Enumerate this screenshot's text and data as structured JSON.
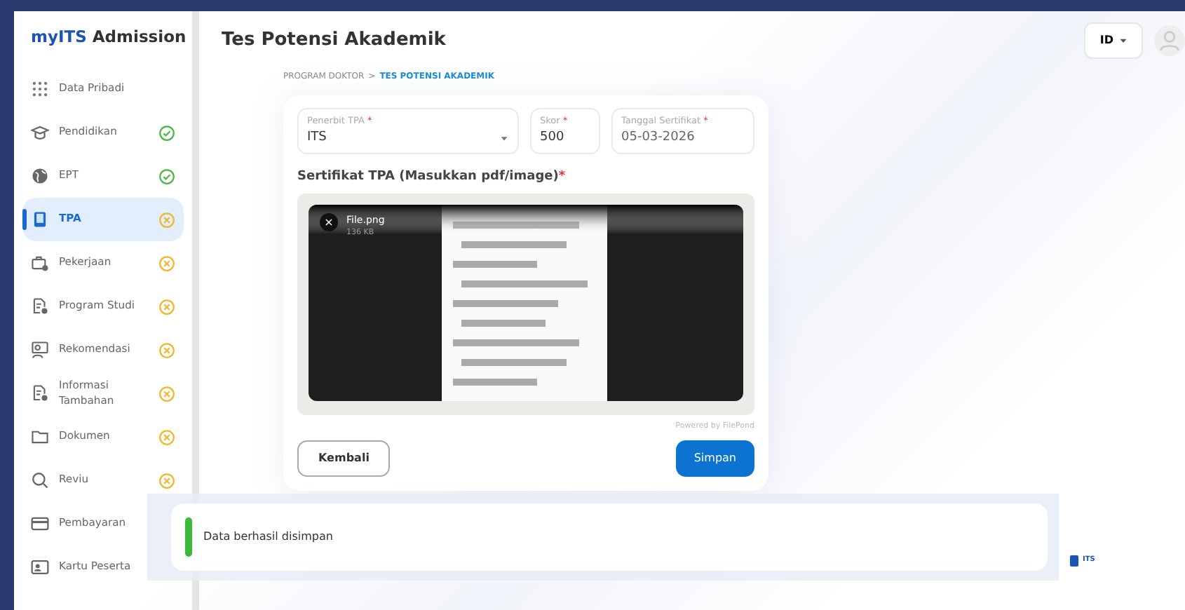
{
  "brand": {
    "prefix": "my",
    "main": "ITS",
    "suffix": "Admission"
  },
  "page_title": "Tes Potensi Akademik",
  "language": "ID",
  "sidebar": {
    "items": [
      {
        "label": "Data Pribadi",
        "kind": "plain",
        "selected": false
      },
      {
        "label": "Pendidikan",
        "kind": "complete",
        "selected": false
      },
      {
        "label": "EPT",
        "kind": "complete",
        "selected": false
      },
      {
        "label": "TPA",
        "kind": "incomplete",
        "selected": true
      },
      {
        "label": "Pekerjaan",
        "kind": "incomplete",
        "selected": false
      },
      {
        "label": "Program Studi",
        "kind": "incomplete",
        "selected": false
      },
      {
        "label": "Rekomendasi",
        "kind": "incomplete",
        "selected": false
      },
      {
        "label": "Informasi Tambahan",
        "kind": "incomplete",
        "selected": false
      },
      {
        "label": "Dokumen",
        "kind": "incomplete",
        "selected": false
      },
      {
        "label": "Reviu",
        "kind": "incomplete",
        "selected": false
      },
      {
        "label": "Pembayaran",
        "kind": "plain",
        "selected": false
      },
      {
        "label": "Kartu Peserta",
        "kind": "plain",
        "selected": false
      }
    ]
  },
  "breadcrumb": [
    {
      "label": "PROGRAM DOKTOR",
      "current": false
    },
    {
      "label": ">",
      "current": false
    },
    {
      "label": "TES POTENSI AKADEMIK",
      "current": true
    }
  ],
  "form": {
    "fields": [
      {
        "kind": "select",
        "label": "Penerbit TPA",
        "required_mark": "*",
        "value": "ITS"
      },
      {
        "kind": "text",
        "label": "Skor",
        "required_mark": "*",
        "value": "500"
      },
      {
        "kind": "date",
        "label": "Tanggal Sertifikat",
        "required_mark": "*",
        "value": "05-03-2026"
      }
    ],
    "upload": {
      "label": "Sertifikat TPA (Masukkan pdf/image)",
      "required_mark": "*",
      "remove_button": "×",
      "file_name": "File.png",
      "file_size": "136 KB",
      "credit": "Powered by FilePond"
    },
    "buttons": [
      {
        "label": "Kembali",
        "kind": "secondary"
      },
      {
        "label": "Simpan",
        "kind": "primary"
      }
    ]
  },
  "toast": {
    "message": "Data berhasil disimpan",
    "kind": "success"
  },
  "footer_logo": {
    "text": "ITS"
  }
}
